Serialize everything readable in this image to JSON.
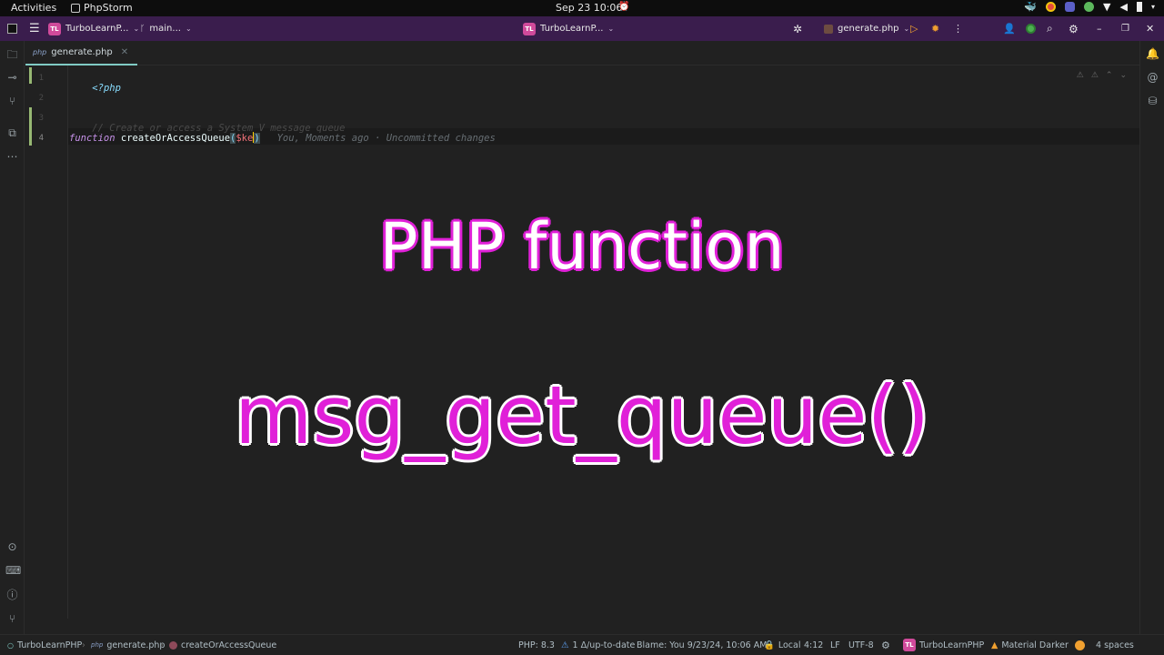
{
  "os_topbar": {
    "activities": "Activities",
    "app_name": "PhpStorm",
    "clock": "Sep 23  10:06"
  },
  "titlebar": {
    "project_badge": "TL",
    "project_name": "TurboLearnP...",
    "branch": "main...",
    "center_project": "TurboLearnP...",
    "run_config": "generate.php"
  },
  "tabs": [
    {
      "label": "generate.php"
    }
  ],
  "editor": {
    "line_numbers": [
      "1",
      "2",
      "3",
      "4"
    ],
    "line1": "<?php",
    "line3_comment": "// Create or access a System V message queue",
    "line4_keyword": "function",
    "line4_name": "createOrAccessQueue",
    "line4_paren": "(",
    "line4_var": "$ke",
    "line4_close": ")",
    "blame": "You, Moments ago · Uncommitted changes"
  },
  "overlay": {
    "title": "PHP function",
    "function_name": "msg_get_queue()"
  },
  "statusbar": {
    "project": "TurboLearnPHP",
    "file": "generate.php",
    "symbol": "createOrAccessQueue",
    "php_version": "PHP: 8.3",
    "vcs_status": "1 Δ/up-to-date",
    "blame": "Blame: You 9/23/24, 10:06 AM",
    "lock": "Local",
    "position": "4:12",
    "line_sep": "LF",
    "encoding": "UTF-8",
    "project_badge": "TL",
    "project_name": "TurboLearnPHP",
    "theme": "Material Darker",
    "indent": "4 spaces"
  },
  "colors": {
    "titlebar": "#3a1d4d",
    "accent_magenta": "#e020d8",
    "editor_bg": "#212121"
  }
}
